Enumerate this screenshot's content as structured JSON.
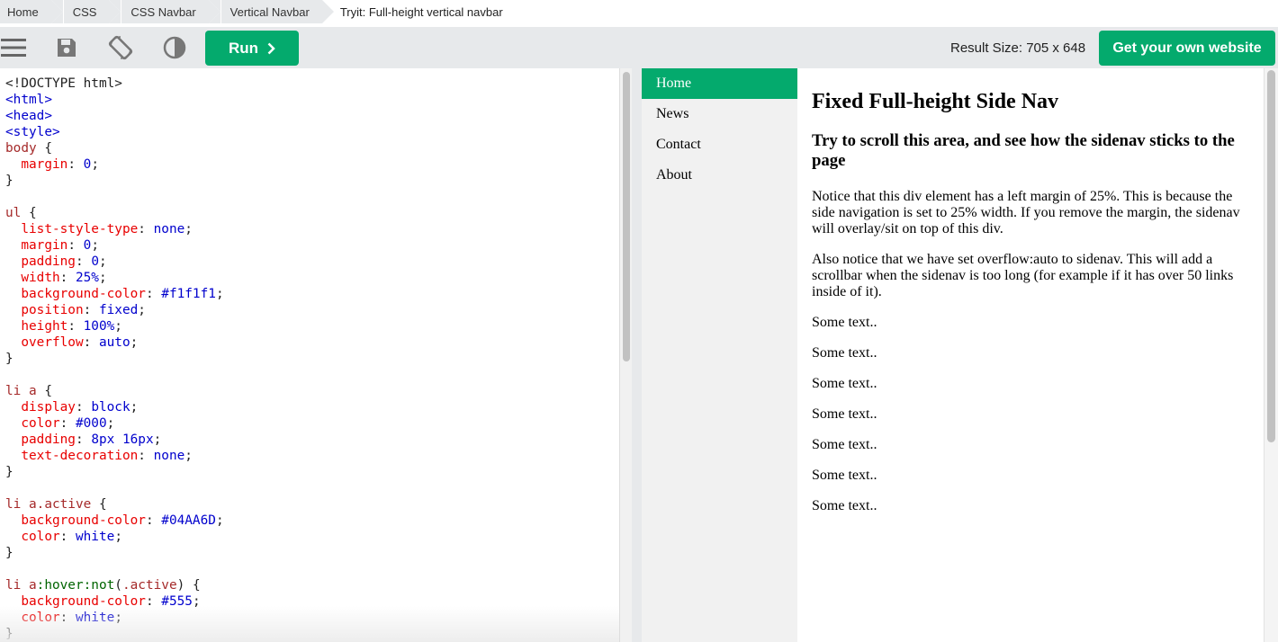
{
  "breadcrumb": {
    "items": [
      "Home",
      "CSS",
      "CSS Navbar",
      "Vertical Navbar"
    ],
    "current": "Tryit: Full-height vertical navbar"
  },
  "toolbar": {
    "icons": [
      "menu-icon",
      "save-icon",
      "rotate-icon",
      "contrast-icon"
    ],
    "run_label": "Run",
    "result_size": "Result Size: 705 x 648",
    "get_website_label": "Get your own website",
    "accent_color": "#04AA6D"
  },
  "code": {
    "lines": [
      [
        [
          "t",
          "<!DOCTYPE html>"
        ]
      ],
      [
        [
          "tag",
          "<html>"
        ]
      ],
      [
        [
          "tag",
          "<head>"
        ]
      ],
      [
        [
          "tag",
          "<style>"
        ]
      ],
      [
        [
          "sel",
          "body"
        ],
        [
          "t",
          " {"
        ]
      ],
      [
        [
          "t",
          "  "
        ],
        [
          "prop",
          "margin"
        ],
        [
          "t",
          ": "
        ],
        [
          "val",
          "0"
        ],
        [
          "t",
          ";"
        ]
      ],
      [
        [
          "t",
          "}"
        ]
      ],
      [
        [
          "t",
          ""
        ]
      ],
      [
        [
          "sel",
          "ul"
        ],
        [
          "t",
          " {"
        ]
      ],
      [
        [
          "t",
          "  "
        ],
        [
          "prop",
          "list-style-type"
        ],
        [
          "t",
          ": "
        ],
        [
          "val",
          "none"
        ],
        [
          "t",
          ";"
        ]
      ],
      [
        [
          "t",
          "  "
        ],
        [
          "prop",
          "margin"
        ],
        [
          "t",
          ": "
        ],
        [
          "val",
          "0"
        ],
        [
          "t",
          ";"
        ]
      ],
      [
        [
          "t",
          "  "
        ],
        [
          "prop",
          "padding"
        ],
        [
          "t",
          ": "
        ],
        [
          "val",
          "0"
        ],
        [
          "t",
          ";"
        ]
      ],
      [
        [
          "t",
          "  "
        ],
        [
          "prop",
          "width"
        ],
        [
          "t",
          ": "
        ],
        [
          "val",
          "25%"
        ],
        [
          "t",
          ";"
        ]
      ],
      [
        [
          "t",
          "  "
        ],
        [
          "prop",
          "background-color"
        ],
        [
          "t",
          ": "
        ],
        [
          "val",
          "#f1f1f1"
        ],
        [
          "t",
          ";"
        ]
      ],
      [
        [
          "t",
          "  "
        ],
        [
          "prop",
          "position"
        ],
        [
          "t",
          ": "
        ],
        [
          "val",
          "fixed"
        ],
        [
          "t",
          ";"
        ]
      ],
      [
        [
          "t",
          "  "
        ],
        [
          "prop",
          "height"
        ],
        [
          "t",
          ": "
        ],
        [
          "val",
          "100%"
        ],
        [
          "t",
          ";"
        ]
      ],
      [
        [
          "t",
          "  "
        ],
        [
          "prop",
          "overflow"
        ],
        [
          "t",
          ": "
        ],
        [
          "val",
          "auto"
        ],
        [
          "t",
          ";"
        ]
      ],
      [
        [
          "t",
          "}"
        ]
      ],
      [
        [
          "t",
          ""
        ]
      ],
      [
        [
          "sel",
          "li a"
        ],
        [
          "t",
          " {"
        ]
      ],
      [
        [
          "t",
          "  "
        ],
        [
          "prop",
          "display"
        ],
        [
          "t",
          ": "
        ],
        [
          "val",
          "block"
        ],
        [
          "t",
          ";"
        ]
      ],
      [
        [
          "t",
          "  "
        ],
        [
          "prop",
          "color"
        ],
        [
          "t",
          ": "
        ],
        [
          "val",
          "#000"
        ],
        [
          "t",
          ";"
        ]
      ],
      [
        [
          "t",
          "  "
        ],
        [
          "prop",
          "padding"
        ],
        [
          "t",
          ": "
        ],
        [
          "val",
          "8px 16px"
        ],
        [
          "t",
          ";"
        ]
      ],
      [
        [
          "t",
          "  "
        ],
        [
          "prop",
          "text-decoration"
        ],
        [
          "t",
          ": "
        ],
        [
          "val",
          "none"
        ],
        [
          "t",
          ";"
        ]
      ],
      [
        [
          "t",
          "}"
        ]
      ],
      [
        [
          "t",
          ""
        ]
      ],
      [
        [
          "sel",
          "li a.active"
        ],
        [
          "t",
          " {"
        ]
      ],
      [
        [
          "t",
          "  "
        ],
        [
          "prop",
          "background-color"
        ],
        [
          "t",
          ": "
        ],
        [
          "val",
          "#04AA6D"
        ],
        [
          "t",
          ";"
        ]
      ],
      [
        [
          "t",
          "  "
        ],
        [
          "prop",
          "color"
        ],
        [
          "t",
          ": "
        ],
        [
          "val",
          "white"
        ],
        [
          "t",
          ";"
        ]
      ],
      [
        [
          "t",
          "}"
        ]
      ],
      [
        [
          "t",
          ""
        ]
      ],
      [
        [
          "sel",
          "li a"
        ],
        [
          "pseudo",
          ":hover:not"
        ],
        [
          "t",
          "("
        ],
        [
          "sel",
          ".active"
        ],
        [
          "t",
          ") {"
        ]
      ],
      [
        [
          "t",
          "  "
        ],
        [
          "prop",
          "background-color"
        ],
        [
          "t",
          ": "
        ],
        [
          "val",
          "#555"
        ],
        [
          "t",
          ";"
        ]
      ],
      [
        [
          "t",
          "  "
        ],
        [
          "prop",
          "color"
        ],
        [
          "t",
          ": "
        ],
        [
          "val",
          "white"
        ],
        [
          "t",
          ";"
        ]
      ],
      [
        [
          "t",
          "}"
        ]
      ]
    ]
  },
  "result": {
    "nav_items": [
      "Home",
      "News",
      "Contact",
      "About"
    ],
    "heading": "Fixed Full-height Side Nav",
    "subheading": "Try to scroll this area, and see how the sidenav sticks to the page",
    "paragraphs": [
      "Notice that this div element has a left margin of 25%. This is because the side navigation is set to 25% width. If you remove the margin, the sidenav will overlay/sit on top of this div.",
      "Also notice that we have set overflow:auto to sidenav. This will add a scrollbar when the sidenav is too long (for example if it has over 50 links inside of it).",
      "Some text..",
      "Some text..",
      "Some text..",
      "Some text..",
      "Some text..",
      "Some text..",
      "Some text.."
    ]
  }
}
